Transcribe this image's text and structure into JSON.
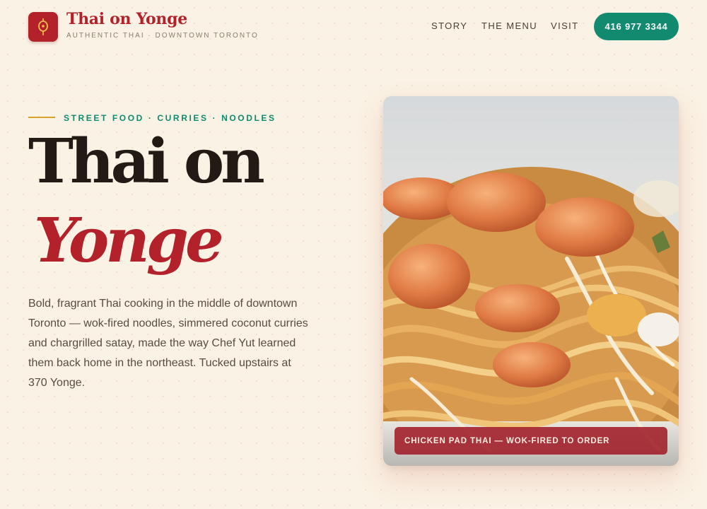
{
  "header": {
    "logo_icon": "lantern-icon",
    "brand_name": "Thai on Yonge",
    "brand_tagline": "AUTHENTIC THAI · DOWNTOWN TORONTO",
    "nav": [
      {
        "label": "STORY"
      },
      {
        "label": "THE MENU"
      },
      {
        "label": "VISIT"
      }
    ],
    "phone_button": "416 977 3344"
  },
  "hero": {
    "eyebrow": "STREET FOOD · CURRIES · NOODLES",
    "title_line1": "Thai on",
    "title_line2": "Yonge",
    "description": "Bold, fragrant Thai cooking in the middle of downtown Toronto — wok-fired noodles, simmered coconut curries and chargrilled satay, made the way Chef Yut learned them back home in the northeast. Tucked upstairs at 370 Yonge.",
    "photo_caption": "CHICKEN PAD THAI — WOK-FIRED TO ORDER"
  },
  "colors": {
    "brand_red": "#b3222b",
    "accent_green": "#118a70",
    "gold": "#d9a22a",
    "background": "#faf2e4"
  }
}
